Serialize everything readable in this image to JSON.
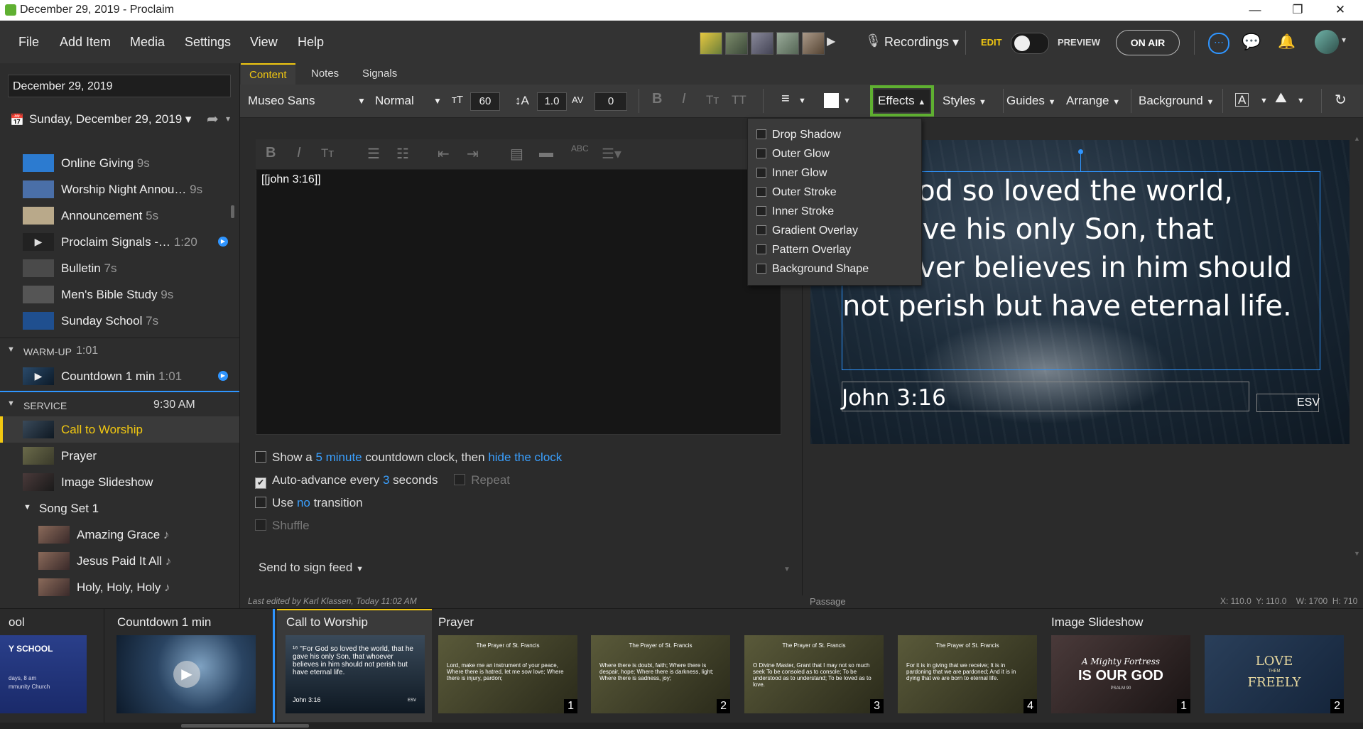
{
  "window": {
    "title": "December 29, 2019 - Proclaim",
    "minimize": "—",
    "restore": "❐",
    "close": "✕"
  },
  "menu": {
    "items": [
      "File",
      "Add Item",
      "Media",
      "Settings",
      "View",
      "Help"
    ],
    "recordings": "Recordings",
    "edit": "EDIT",
    "preview": "PREVIEW",
    "on_air": "ON AIR"
  },
  "left": {
    "date_value": "December 29, 2019",
    "service_date": "Sunday, December 29, 2019",
    "pre_service": [
      {
        "label": "Online Giving",
        "dur": "9s",
        "color": "#2c7bd0"
      },
      {
        "label": "Worship Night Annou…",
        "dur": "9s",
        "color": "#4a6fa8"
      },
      {
        "label": "Announcement",
        "dur": "5s",
        "color": "#b9a98a"
      },
      {
        "label": "Proclaim Signals -…",
        "dur": "1:20",
        "color": "#222"
      },
      {
        "label": "Bulletin",
        "dur": "7s",
        "color": "#4a4a4a"
      },
      {
        "label": "Men's Bible Study",
        "dur": "9s",
        "color": "#555"
      },
      {
        "label": "Sunday School",
        "dur": "7s",
        "color": "#1f4f8f"
      }
    ],
    "warmup": {
      "title": "WARM-UP",
      "time": "1:01",
      "item": {
        "label": "Countdown 1 min",
        "dur": "1:01"
      }
    },
    "service": {
      "title": "SERVICE",
      "time": "9:30 AM",
      "items": [
        "Call to Worship",
        "Prayer",
        "Image Slideshow"
      ],
      "song_set": "Song Set 1",
      "songs": [
        "Amazing Grace",
        "Jesus Paid It All",
        "Holy, Holy, Holy"
      ]
    }
  },
  "tabs": [
    "Content",
    "Notes",
    "Signals"
  ],
  "toolbar": {
    "font": "Museo Sans",
    "weight": "Normal",
    "size": "60",
    "line_height": "1.0",
    "tracking": "0",
    "effects": "Effects",
    "styles": "Styles",
    "guides": "Guides",
    "arrange": "Arrange",
    "background": "Background"
  },
  "editor": {
    "content": "[[john 3:16]]",
    "countdown": {
      "prefix": "Show a",
      "link1": "5 minute",
      "mid": "countdown clock, then",
      "link2": "hide the clock"
    },
    "autoadvance": {
      "prefix": "Auto-advance every",
      "link": "3",
      "suffix": "seconds",
      "repeat": "Repeat"
    },
    "transition": {
      "prefix": "Use",
      "link": "no",
      "suffix": "transition"
    },
    "shuffle": "Shuffle",
    "send": "Send to sign feed",
    "last_edited": "Last edited by Karl Klassen, Today 11:02 AM"
  },
  "effects_menu": [
    "Drop Shadow",
    "Outer Glow",
    "Inner Glow",
    "Outer Stroke",
    "Inner Stroke",
    "Gradient Overlay",
    "Pattern Overlay",
    "Background Shape"
  ],
  "preview": {
    "verse_lines": [
      "For God so loved the world,",
      "he gave his only Son, that",
      "whoever believes in him should",
      "not perish but have eternal life."
    ],
    "reference": "John 3:16",
    "version": "ESV",
    "passage_label": "Passage",
    "coords": "X: 110.0  Y: 110.0    W: 1700  H: 710"
  },
  "bottom": {
    "groups": [
      {
        "title": "ool"
      },
      {
        "title": "Countdown 1 min"
      },
      {
        "title": "Call to Worship"
      },
      {
        "title": "Prayer"
      },
      {
        "title": "Image Slideshow"
      }
    ],
    "school_slide": {
      "title": "Y SCHOOL",
      "line1": "days, 8 am",
      "line2": "mmunity Church"
    },
    "call_slide": {
      "text": "¹⁶ \"For God so loved the world, that he gave his only Son, that whoever believes in him should not perish but have eternal life.",
      "ref": "John 3:16",
      "ver": "ESV"
    },
    "prayer_caption": "The Prayer of St. Francis",
    "prayer_slides": [
      {
        "num": "1",
        "body": "Lord, make me an instrument of your peace, Where there is hatred, let me sow love; Where there is injury, pardon;"
      },
      {
        "num": "2",
        "body": "Where there is doubt, faith; Where there is despair, hope; Where there is darkness, light; Where there is sadness, joy;"
      },
      {
        "num": "3",
        "body": "O Divine Master, Grant that I may not so much seek To be consoled as to console; To be understood as to understand; To be loved as to love."
      },
      {
        "num": "4",
        "body": "For it is in giving that we receive; It is in pardoning that we are pardoned; And it is in dying that we are born to eternal life."
      }
    ],
    "slideshow": [
      {
        "num": "1",
        "line1": "A Mighty Fortress",
        "line2": "IS OUR GOD",
        "line3": "PSALM 90"
      },
      {
        "num": "2",
        "line1": "LOVE",
        "line2": "THEM",
        "line3": "FREELY"
      }
    ]
  },
  "colors": {
    "accent": "#f2c811",
    "link": "#3aa0ff",
    "highlight": "#5fb031",
    "selection": "#2f95ff"
  }
}
